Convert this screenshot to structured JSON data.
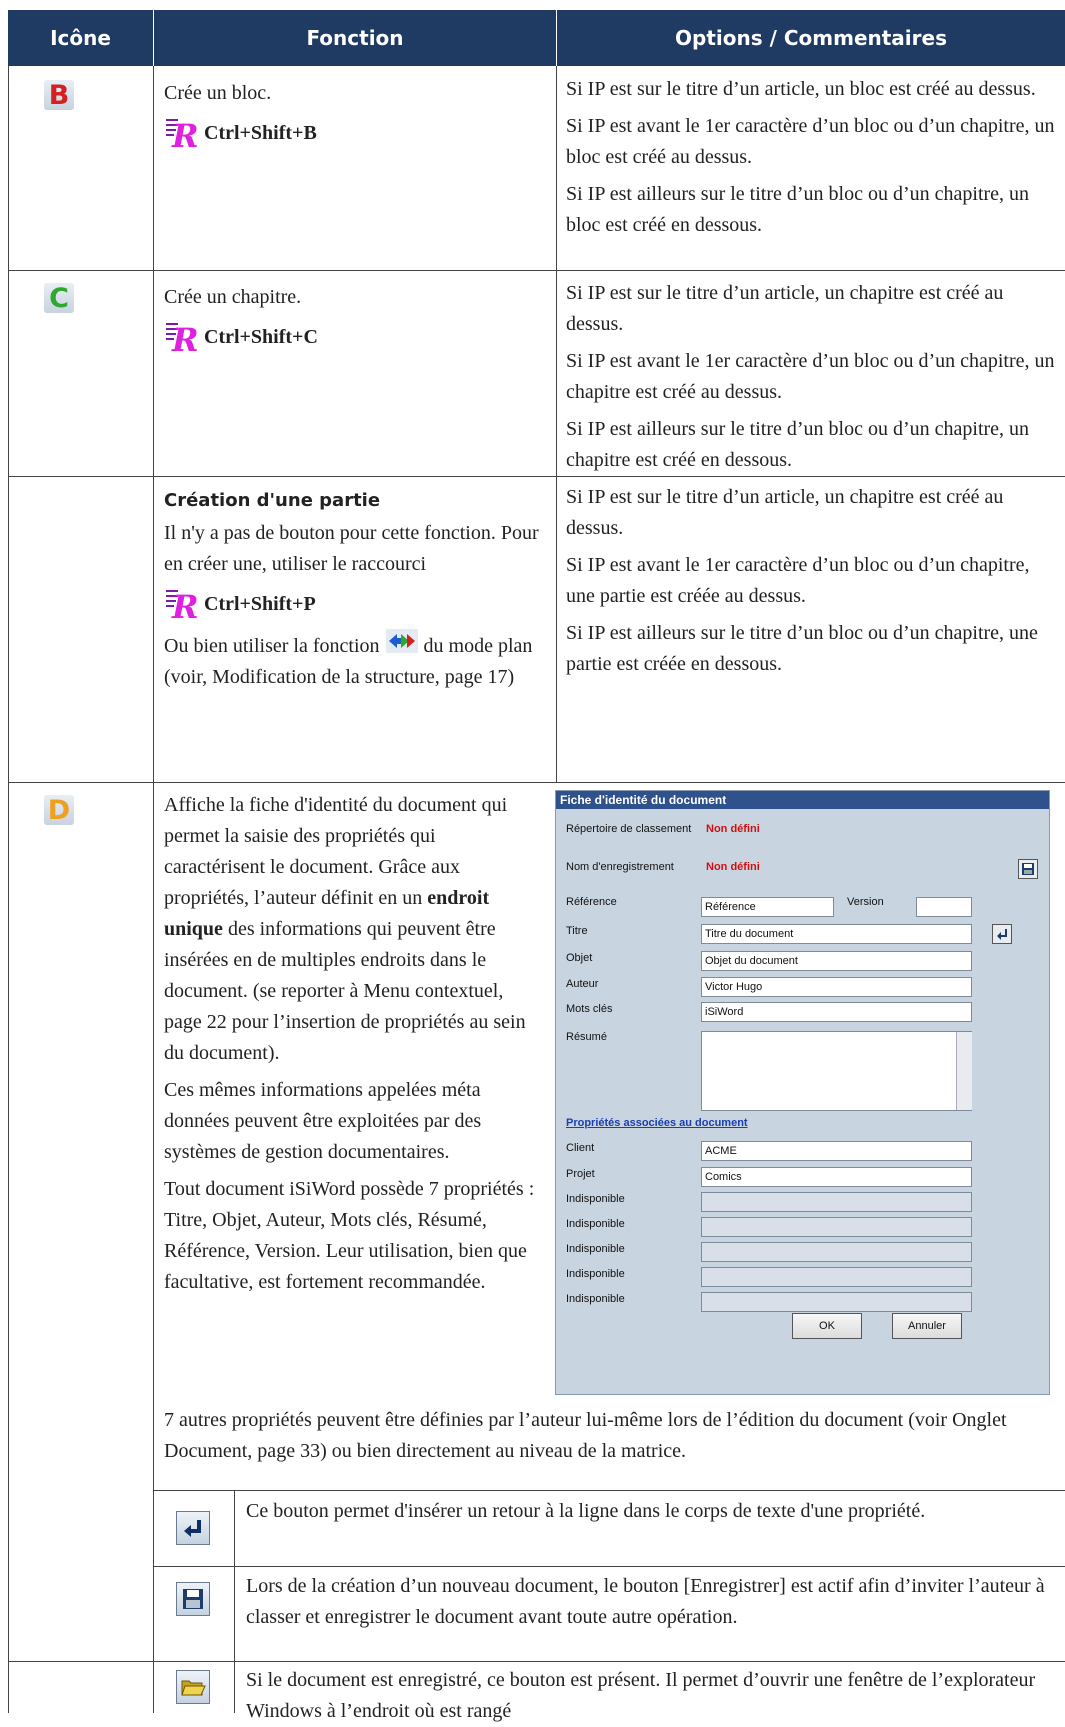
{
  "header": {
    "col1": "Icône",
    "col2": "Fonction",
    "col3": "Options / Commentaires"
  },
  "rows": [
    {
      "icon_letter": "B",
      "icon_color": "#d42020",
      "fonction": "Crée un bloc.",
      "shortcut": "Ctrl+Shift+B",
      "comments": [
        "Si IP est sur le titre d’un article, un bloc est créé au dessus.",
        "Si IP est avant le 1er caractère d’un bloc ou d’un chapitre, un bloc est créé au dessus.",
        "Si IP est ailleurs sur le titre d’un bloc ou d’un chapitre, un bloc est créé en dessous."
      ]
    },
    {
      "icon_letter": "C",
      "icon_color": "#2fa82f",
      "fonction": "Crée un chapitre.",
      "shortcut": "Ctrl+Shift+C",
      "comments": [
        "Si IP est sur le titre d’un article, un chapitre est créé au dessus.",
        "Si IP est avant le 1er caractère d’un bloc ou d’un chapitre, un chapitre est créé au dessus.",
        "Si IP est ailleurs sur le titre d’un bloc ou d’un chapitre, un chapitre est créé en dessous."
      ]
    },
    {
      "fonction_title": "Création d'une partie",
      "fonction_text": "Il n'y a pas de bouton pour cette fonction. Pour en créer une, utiliser le raccourci",
      "shortcut": "Ctrl+Shift+P",
      "fonction_text2a": "Ou bien utiliser la fonction",
      "fonction_text2b": "du mode plan (voir, Modification de la structure, page 17)",
      "comments": [
        "Si IP est sur le titre d’un article, un chapitre est créé au dessus.",
        "Si IP est avant le 1er caractère d’un bloc ou d’un chapitre, une partie est créée au dessus.",
        "Si IP est ailleurs sur le titre d’un bloc ou d’un chapitre, une partie est créée en dessous."
      ]
    },
    {
      "icon_letter": "D",
      "icon_color": "#f0a020",
      "para1_a": "Affiche la fiche d'identité du document qui permet la saisie des propriétés qui caractérisent le document. Grâce aux propriétés, l’auteur définit en un ",
      "para1_bold": "endroit unique",
      "para1_b": " des informations qui peuvent être insérées en de multiples endroits dans le document. (se reporter à Menu contextuel, page 22 pour l’insertion de propriétés au sein du document).",
      "para2": "Ces mêmes informations appelées méta données peuvent être exploitées par des systèmes de gestion documentaires.",
      "para3": "Tout document iSiWord possède 7 propriétés : Titre, Objet, Auteur, Mots clés, Résumé, Référence, Version. Leur utilisation, bien que facultative, est fortement recommandée.",
      "para4": "7 autres propriétés peuvent être définies par l’auteur lui-même lors de l’édition du document (voir Onglet Document, page 33) ou bien directement au niveau de la matrice.",
      "sub": [
        {
          "icon": "return-icon",
          "text": "Ce bouton permet d'insérer un retour à la ligne dans le corps de texte d'une propriété."
        },
        {
          "icon": "save-icon",
          "text": "Lors de la création d’un nouveau document, le bouton [Enregistrer] est actif afin d’inviter l’auteur à classer et enregistrer le document avant toute autre opération."
        },
        {
          "icon": "folder-icon",
          "text": "Si le document est enregistré, ce bouton est présent. Il permet d’ouvrir une fenêtre de l’explorateur Windows à l’endroit où est rangé"
        }
      ]
    }
  ],
  "dialog": {
    "title": "Fiche d'identité du document",
    "repertoire_label": "Répertoire de classement",
    "repertoire_value": "Non défini",
    "nom_label": "Nom d'enregistrement",
    "nom_value": "Non défini",
    "reference_label": "Référence",
    "reference_value": "Référence",
    "version_label": "Version",
    "version_value": "",
    "titre_label": "Titre",
    "titre_value": "Titre du document",
    "objet_label": "Objet",
    "objet_value": "Objet du document",
    "auteur_label": "Auteur",
    "auteur_value": "Victor Hugo",
    "mots_label": "Mots clés",
    "mots_value": "iSiWord",
    "resume_label": "Résumé",
    "resume_value": "",
    "assoc_link": "Propriétés associées au document",
    "client_label": "Client",
    "client_value": "ACME",
    "projet_label": "Projet",
    "projet_value": "Comics",
    "indispo_label": "Indisponible",
    "ok_label": "OK",
    "cancel_label": "Annuler"
  }
}
